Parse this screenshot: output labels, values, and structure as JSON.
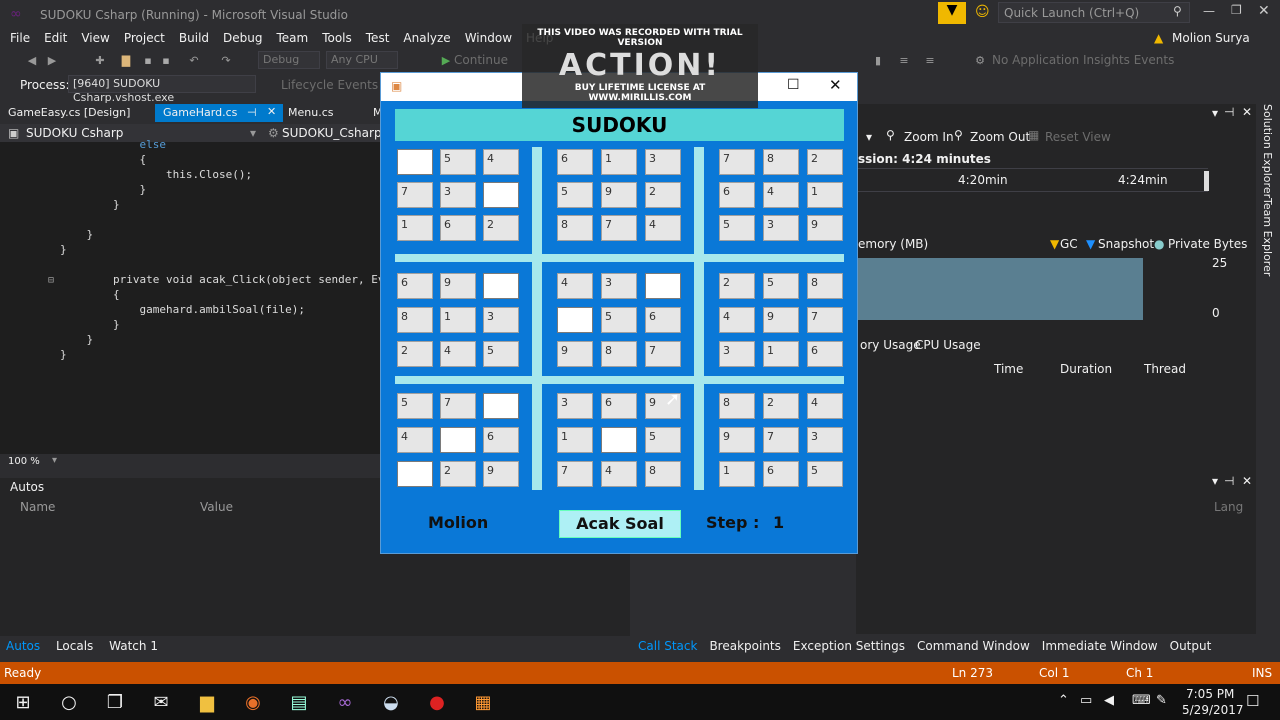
{
  "window": {
    "title": "SUDOKU Csharp (Running) - Microsoft Visual Studio",
    "quick_launch": "Quick Launch (Ctrl+Q)",
    "user": "Molion Surya"
  },
  "menu": [
    "File",
    "Edit",
    "View",
    "Project",
    "Build",
    "Debug",
    "Team",
    "Tools",
    "Test",
    "Analyze",
    "Window",
    "Help"
  ],
  "toolbar": {
    "config": "Debug",
    "platform": "Any CPU",
    "continue": "Continue",
    "insights": "No Application Insights Events"
  },
  "process": {
    "label": "Process:",
    "value": "[9640] SUDOKU Csharp.vshost.exe",
    "lifecycle": "Lifecycle Events"
  },
  "doc_tabs": [
    "GameEasy.cs [Design]",
    "GameHard.cs",
    "Menu.cs",
    "M"
  ],
  "nav": {
    "project": "SUDOKU Csharp",
    "class": "SUDOKU_Csharp.ga"
  },
  "code_lines": [
    {
      "indent": "            ",
      "text": "else",
      "kw": true
    },
    {
      "indent": "            ",
      "text": "{"
    },
    {
      "indent": "                ",
      "text": "this.Close();"
    },
    {
      "indent": "            ",
      "text": "}"
    },
    {
      "indent": "        ",
      "text": "}"
    },
    {
      "indent": "",
      "text": ""
    },
    {
      "indent": "    ",
      "text": "}"
    },
    {
      "indent": "",
      "text": "}"
    },
    {
      "indent": "",
      "text": ""
    },
    {
      "indent": "        ",
      "text": "private void acak_Click(object sender, Ev"
    },
    {
      "indent": "        ",
      "text": "{"
    },
    {
      "indent": "            ",
      "text": "gamehard.ambilSoal(file);"
    },
    {
      "indent": "        ",
      "text": "}"
    },
    {
      "indent": "    ",
      "text": "}"
    },
    {
      "indent": "",
      "text": "}"
    }
  ],
  "zoom": "100 %",
  "autos": {
    "title": "Autos",
    "col_name": "Name",
    "col_value": "Value",
    "col_lang": "Lang"
  },
  "autos_tabs": [
    "Autos",
    "Locals",
    "Watch 1"
  ],
  "diag": {
    "zoom_in": "Zoom In",
    "zoom_out": "Zoom Out",
    "reset_view": "Reset View",
    "session": "ssion: 4:24 minutes",
    "t1": "4:20min",
    "t2": "4:24min",
    "memory": "emory (MB)",
    "gc": "GC",
    "snapshot": "Snapshot",
    "private_bytes": "Private Bytes",
    "ymax": "25",
    "ymin": "0",
    "tabs": [
      "ory Usage",
      "CPU Usage"
    ],
    "cols": [
      "Time",
      "Duration",
      "Thread"
    ],
    "memory_fill": 0.82
  },
  "callstack_tabs": [
    "Call Stack",
    "Breakpoints",
    "Exception Settings",
    "Command Window",
    "Immediate Window",
    "Output"
  ],
  "status": {
    "ready": "Ready",
    "ln": "Ln 273",
    "col": "Col 1",
    "ch": "Ch 1",
    "ins": "INS"
  },
  "side_tabs": [
    "Solution Explorer",
    "Team Explorer"
  ],
  "watermark": {
    "top": "THIS VIDEO WAS RECORDED WITH TRIAL VERSION",
    "logo": "ACTION!",
    "bottom": "BUY LIFETIME LICENSE AT WWW.MIRILLIS.COM"
  },
  "sudoku": {
    "title": "SUDOKU",
    "grid": [
      [
        "",
        "5",
        "4",
        "6",
        "1",
        "3",
        "7",
        "8",
        "2"
      ],
      [
        "7",
        "3",
        "",
        "5",
        "9",
        "2",
        "6",
        "4",
        "1"
      ],
      [
        "1",
        "6",
        "2",
        "8",
        "7",
        "4",
        "5",
        "3",
        "9"
      ],
      [
        "6",
        "9",
        "",
        "4",
        "3",
        "",
        "2",
        "5",
        "8"
      ],
      [
        "8",
        "1",
        "3",
        "",
        "5",
        "6",
        "4",
        "9",
        "7"
      ],
      [
        "2",
        "4",
        "5",
        "9",
        "8",
        "7",
        "3",
        "1",
        "6"
      ],
      [
        "5",
        "7",
        "",
        "3",
        "6",
        "9",
        "8",
        "2",
        "4"
      ],
      [
        "4",
        "",
        "6",
        "1",
        "",
        "5",
        "9",
        "7",
        "3"
      ],
      [
        "",
        "2",
        "9",
        "7",
        "4",
        "8",
        "1",
        "6",
        "5"
      ]
    ],
    "player": "Molion",
    "button": "Acak Soal",
    "step_label": "Step :",
    "step_value": "1"
  },
  "clock": {
    "time": "7:05 PM",
    "date": "5/29/2017"
  }
}
